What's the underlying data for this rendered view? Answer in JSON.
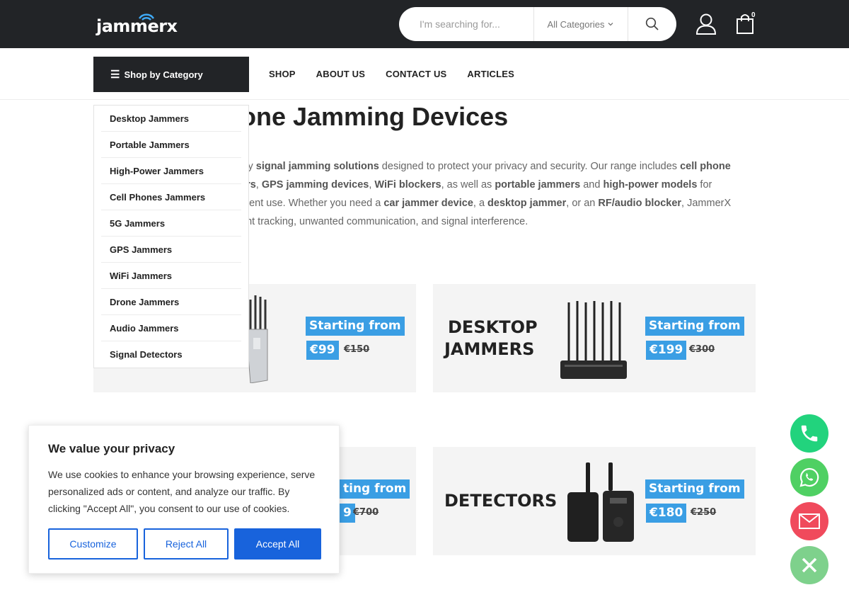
{
  "header": {
    "logo_text": "jammerx",
    "search_placeholder": "I'm searching for...",
    "category_select": "All Categories",
    "cart_count": "0"
  },
  "nav": {
    "shop_by_category": "Shop by Category",
    "menu": [
      "SHOP",
      "ABOUT US",
      "CONTACT US",
      "ARTICLES"
    ]
  },
  "dropdown": {
    "items": [
      "Desktop Jammers",
      "Portable Jammers",
      "High-Power Jammers",
      "Cell Phones Jammers",
      "5G Jammers",
      "GPS Jammers",
      "WiFi Jammers",
      "Drone Jammers",
      "Audio Jammers",
      "Signal Detectors"
    ]
  },
  "main": {
    "heading_visible": "one Jamming Devices",
    "intro": {
      "l1a": "lity ",
      "l1b": "signal jamming solutions",
      "l1c": " designed to protect your privacy and security. Our range includes ",
      "l1d": "cell phone",
      "l2a": "ers",
      "l2b": ", ",
      "l2c": "GPS jamming devices",
      "l2d": ", ",
      "l2e": "WiFi blockers",
      "l2f": ", as well as ",
      "l2g": "portable jammers",
      "l2h": " and ",
      "l2i": "high-power models",
      "l2j": " for",
      "l3a": "ment use. Whether you need a ",
      "l3b": "car jammer device",
      "l3c": ", a ",
      "l3d": "desktop jammer",
      "l3e": ", or an ",
      "l3f": "RF/audio blocker",
      "l3g": ", JammerX",
      "l4": "ent tracking, unwanted communication, and signal interference."
    }
  },
  "banners": [
    {
      "title": "",
      "starting": "Starting from",
      "price": "€99",
      "old_price": "€150"
    },
    {
      "title_l1": "DESKTOP",
      "title_l2": "JAMMERS",
      "starting": "Starting from",
      "price": "€199",
      "old_price": "€300"
    },
    {
      "starting": "ting from",
      "price": "9",
      "old_price": "€700"
    },
    {
      "title": "DETECTORS",
      "starting": "Starting from",
      "price": "€180",
      "old_price": "€250"
    }
  ],
  "cookie": {
    "title": "We value your privacy",
    "text": "We use cookies to enhance your browsing experience, serve personalized ads or content, and analyze our traffic. By clicking \"Accept All\", you consent to our use of cookies.",
    "customize": "Customize",
    "reject": "Reject All",
    "accept": "Accept All"
  },
  "floating": {
    "phone_color": "#22d37d",
    "whatsapp_color": "#4fd063",
    "email_color": "#f04a5c",
    "close_color": "#7ed18c"
  }
}
